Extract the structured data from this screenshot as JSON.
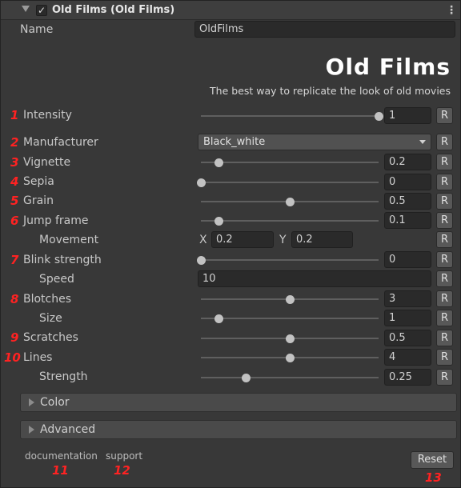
{
  "header": {
    "title": "Old Films (Old Films)",
    "checkbox_checked": true,
    "checkmark": "✓",
    "menu_glyph": "⋮"
  },
  "name_row": {
    "label": "Name",
    "value": "OldFilms"
  },
  "branding": {
    "logo": "Old Films",
    "tagline": "The best way to replicate the look of old movies"
  },
  "reset_label": "R",
  "rows": {
    "intensity": {
      "marker": "1",
      "label": "Intensity",
      "value": "1",
      "slider": 1.0
    },
    "manufacturer": {
      "marker": "2",
      "label": "Manufacturer",
      "value": "Black_white"
    },
    "vignette": {
      "marker": "3",
      "label": "Vignette",
      "value": "0.2",
      "slider": 0.1
    },
    "sepia": {
      "marker": "4",
      "label": "Sepia",
      "value": "0",
      "slider": 0.0
    },
    "grain": {
      "marker": "5",
      "label": "Grain",
      "value": "0.5",
      "slider": 0.5
    },
    "jump_frame": {
      "marker": "6",
      "label": "Jump frame",
      "value": "0.1",
      "slider": 0.1
    },
    "movement": {
      "label": "Movement",
      "x_label": "X",
      "x_value": "0.2",
      "y_label": "Y",
      "y_value": "0.2"
    },
    "blink_strength": {
      "marker": "7",
      "label": "Blink strength",
      "value": "0",
      "slider": 0.0
    },
    "speed": {
      "label": "Speed",
      "value": "10"
    },
    "blotches": {
      "marker": "8",
      "label": "Blotches",
      "value": "3",
      "slider": 0.5
    },
    "size": {
      "label": "Size",
      "value": "1",
      "slider": 0.1
    },
    "scratches": {
      "marker": "9",
      "label": "Scratches",
      "value": "0.5",
      "slider": 0.5
    },
    "lines": {
      "marker": "10",
      "label": "Lines",
      "value": "4",
      "slider": 0.5
    },
    "strength": {
      "label": "Strength",
      "value": "0.25",
      "slider": 0.25
    }
  },
  "foldouts": {
    "color": "Color",
    "advanced": "Advanced"
  },
  "footer": {
    "documentation": "documentation",
    "documentation_marker": "11",
    "support": "support",
    "support_marker": "12",
    "reset": "Reset",
    "reset_marker": "13"
  },
  "colors": {
    "marker": "#ff2222",
    "background": "#383838",
    "field": "#2a2a2a"
  }
}
